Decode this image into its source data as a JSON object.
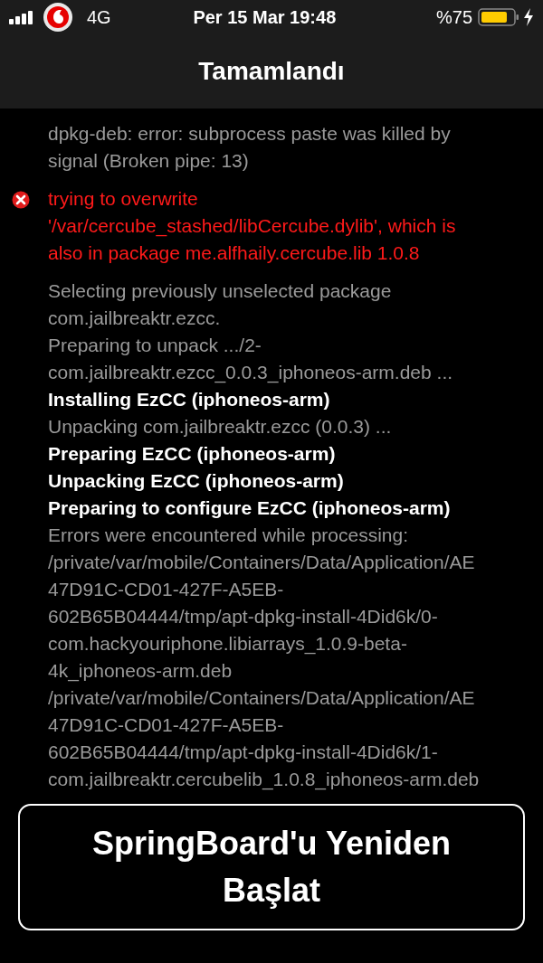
{
  "status_bar": {
    "network": "4G",
    "time": "Per 15 Mar 19:48",
    "battery": "%75"
  },
  "nav_bar": {
    "title": "Tamamlandı"
  },
  "log": [
    {
      "kind": "plain",
      "lines": [
        {
          "text": "dpkg-deb: error: subprocess paste was killed by",
          "bold": false
        },
        {
          "text": "signal (Broken pipe: 13)",
          "bold": false
        }
      ]
    },
    {
      "kind": "error",
      "lines": [
        {
          "text": "trying to overwrite",
          "bold": false
        },
        {
          "text": "'/var/cercube_stashed/libCercube.dylib', which is",
          "bold": false
        },
        {
          "text": "also in package me.alfhaily.cercube.lib 1.0.8",
          "bold": false
        }
      ]
    },
    {
      "kind": "plain",
      "lines": [
        {
          "text": "Selecting previously unselected package",
          "bold": false
        },
        {
          "text": "com.jailbreaktr.ezcc.",
          "bold": false
        },
        {
          "text": "Preparing to unpack .../2-",
          "bold": false
        },
        {
          "text": "com.jailbreaktr.ezcc_0.0.3_iphoneos-arm.deb ...",
          "bold": false
        },
        {
          "text": "Installing EzCC (iphoneos-arm)",
          "bold": true
        },
        {
          "text": "Unpacking com.jailbreaktr.ezcc (0.0.3) ...",
          "bold": false
        },
        {
          "text": "Preparing EzCC (iphoneos-arm)",
          "bold": true
        },
        {
          "text": "Unpacking EzCC (iphoneos-arm)",
          "bold": true
        },
        {
          "text": "Preparing to configure EzCC (iphoneos-arm)",
          "bold": true
        },
        {
          "text": "Errors were encountered while processing:",
          "bold": false
        },
        {
          "text": "/private/var/mobile/Containers/Data/Application/AE",
          "bold": false
        },
        {
          "text": "47D91C-CD01-427F-A5EB-",
          "bold": false
        },
        {
          "text": "602B65B04444/tmp/apt-dpkg-install-4Did6k/0-",
          "bold": false
        },
        {
          "text": "com.hackyouriphone.libiarrays_1.0.9-beta-",
          "bold": false
        },
        {
          "text": "4k_iphoneos-arm.deb",
          "bold": false
        },
        {
          "text": "/private/var/mobile/Containers/Data/Application/AE",
          "bold": false
        },
        {
          "text": "47D91C-CD01-427F-A5EB-",
          "bold": false
        },
        {
          "text": "602B65B04444/tmp/apt-dpkg-install-4Did6k/1-",
          "bold": false
        },
        {
          "text": "com.jailbreaktr.cercubelib_1.0.8_iphoneos-arm.deb",
          "bold": false
        }
      ]
    }
  ],
  "button": {
    "label": "SpringBoard'u Yeniden Başlat"
  }
}
